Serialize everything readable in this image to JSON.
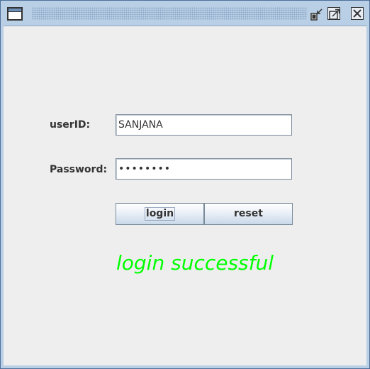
{
  "window": {
    "title": ""
  },
  "form": {
    "userid_label": "userID:",
    "userid_value": "SANJANA",
    "password_label": "Password:",
    "password_value": "••••••••"
  },
  "buttons": {
    "login_label": "login",
    "reset_label": "reset"
  },
  "status": {
    "message": "login successful",
    "color": "#00ff00"
  },
  "icons": {
    "window": "window-icon",
    "minimize": "minimize-icon",
    "maximize": "maximize-icon",
    "close": "close-icon"
  }
}
